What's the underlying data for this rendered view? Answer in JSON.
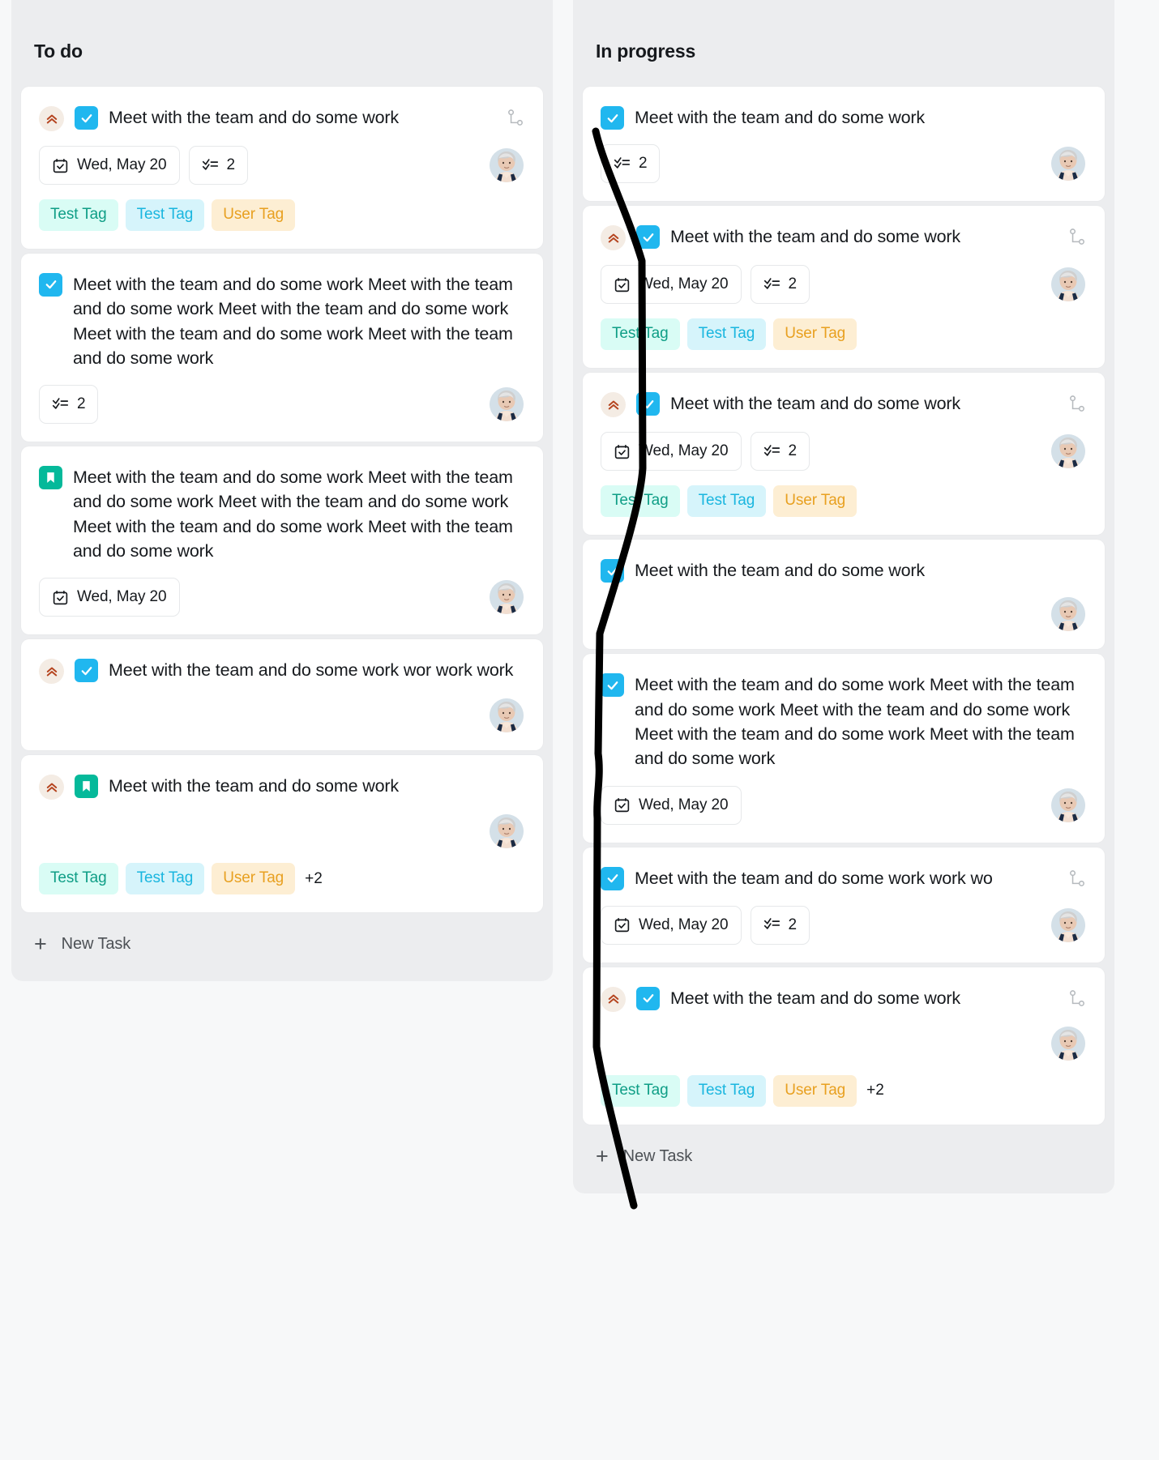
{
  "columns": [
    {
      "title": "To do",
      "new_task_label": "New Task",
      "cards": [
        {
          "leading_icon": "priority-high-icon",
          "status_icon": "checkbox-checked-icon",
          "title": "Meet with the team and do some work",
          "branch_icon": "subtask-branch-icon",
          "date": "Wed, May 20",
          "checklist_count": "2",
          "avatar": "user-avatar",
          "tags": [
            {
              "label": "Test Tag",
              "style": "mint"
            },
            {
              "label": "Test Tag",
              "style": "cyan"
            },
            {
              "label": "User Tag",
              "style": "amber"
            }
          ],
          "tags_overflow": ""
        },
        {
          "leading_icon": "",
          "status_icon": "checkbox-checked-icon",
          "title": "Meet with the team and do some work Meet with the team and do some work Meet with the team and do some work Meet with the team and do some work Meet with the team and do some work",
          "branch_icon": "",
          "date": "",
          "checklist_count": "2",
          "avatar": "user-avatar",
          "tags": [],
          "tags_overflow": ""
        },
        {
          "leading_icon": "",
          "status_icon": "bookmark-icon",
          "title": "Meet with the team and do some work Meet with the team and do some work Meet with the team and do some work Meet with the team and do some work Meet with the team and do some work",
          "branch_icon": "",
          "date": "Wed, May 20",
          "checklist_count": "",
          "avatar": "user-avatar",
          "tags": [],
          "tags_overflow": ""
        },
        {
          "leading_icon": "priority-high-icon",
          "status_icon": "checkbox-checked-icon",
          "title": "Meet with the team and do some work wor work work",
          "branch_icon": "",
          "date": "",
          "checklist_count": "",
          "avatar": "user-avatar",
          "tags": [],
          "tags_overflow": ""
        },
        {
          "leading_icon": "priority-high-icon",
          "status_icon": "bookmark-icon",
          "title": "Meet with the team and do some work",
          "branch_icon": "",
          "date": "",
          "checklist_count": "",
          "avatar": "user-avatar",
          "tags": [
            {
              "label": "Test Tag",
              "style": "mint"
            },
            {
              "label": "Test Tag",
              "style": "cyan"
            },
            {
              "label": "User Tag",
              "style": "amber"
            }
          ],
          "tags_overflow": "+2"
        }
      ]
    },
    {
      "title": "In progress",
      "new_task_label": "New Task",
      "cards": [
        {
          "leading_icon": "",
          "status_icon": "checkbox-checked-icon",
          "title": "Meet with the team and do some work",
          "branch_icon": "",
          "date": "",
          "checklist_count": "2",
          "avatar": "user-avatar",
          "tags": [],
          "tags_overflow": ""
        },
        {
          "leading_icon": "priority-high-icon",
          "status_icon": "checkbox-checked-icon",
          "title": "Meet with the team and do some work",
          "branch_icon": "subtask-branch-icon",
          "date": "Wed, May 20",
          "checklist_count": "2",
          "avatar": "user-avatar",
          "tags": [
            {
              "label": "Test Tag",
              "style": "mint"
            },
            {
              "label": "Test Tag",
              "style": "cyan"
            },
            {
              "label": "User Tag",
              "style": "amber"
            }
          ],
          "tags_overflow": ""
        },
        {
          "leading_icon": "priority-high-icon",
          "status_icon": "checkbox-checked-icon",
          "title": "Meet with the team and do some work",
          "branch_icon": "subtask-branch-icon",
          "date": "Wed, May 20",
          "checklist_count": "2",
          "avatar": "user-avatar",
          "tags": [
            {
              "label": "Test Tag",
              "style": "mint"
            },
            {
              "label": "Test Tag",
              "style": "cyan"
            },
            {
              "label": "User Tag",
              "style": "amber"
            }
          ],
          "tags_overflow": ""
        },
        {
          "leading_icon": "",
          "status_icon": "checkbox-checked-icon",
          "title": "Meet with the team and do some work",
          "branch_icon": "",
          "date": "",
          "checklist_count": "",
          "avatar": "user-avatar",
          "tags": [],
          "tags_overflow": ""
        },
        {
          "leading_icon": "",
          "status_icon": "checkbox-checked-icon",
          "title": "Meet with the team and do some work Meet with the team and do some work Meet with the team and do some work Meet with the team and do some work Meet with the team and do some work",
          "branch_icon": "",
          "date": "Wed, May 20",
          "checklist_count": "",
          "avatar": "user-avatar",
          "tags": [],
          "tags_overflow": ""
        },
        {
          "leading_icon": "",
          "status_icon": "checkbox-checked-icon",
          "title": "Meet with the team and do some work work wo",
          "branch_icon": "subtask-branch-icon",
          "date": "Wed, May 20",
          "checklist_count": "2",
          "avatar": "user-avatar",
          "tags": [],
          "tags_overflow": ""
        },
        {
          "leading_icon": "priority-high-icon",
          "status_icon": "checkbox-checked-icon",
          "title": "Meet with the team and do some work",
          "branch_icon": "subtask-branch-icon",
          "date": "",
          "checklist_count": "",
          "avatar": "user-avatar",
          "tags": [
            {
              "label": "Test Tag",
              "style": "mint"
            },
            {
              "label": "Test Tag",
              "style": "cyan"
            },
            {
              "label": "User Tag",
              "style": "amber"
            }
          ],
          "tags_overflow": "+2"
        }
      ]
    }
  ],
  "annotation": {
    "type": "freehand-ink-stroke",
    "color": "#000000"
  },
  "colors": {
    "checkbox": "#20b7ef",
    "bookmark": "#05b99a",
    "tag_mint_bg": "#d9fcf5",
    "tag_mint_fg": "#0f9e86",
    "tag_cyan_bg": "#d6f4fb",
    "tag_cyan_fg": "#1ab6df",
    "tag_amber_bg": "#fdeed3",
    "tag_amber_fg": "#e8a020",
    "priority_badge_bg": "#f4ece4",
    "priority_chevron": "#b5441f",
    "column_bg": "#ecedef",
    "page_bg": "#f7f8f9",
    "card_bg": "#ffffff"
  }
}
